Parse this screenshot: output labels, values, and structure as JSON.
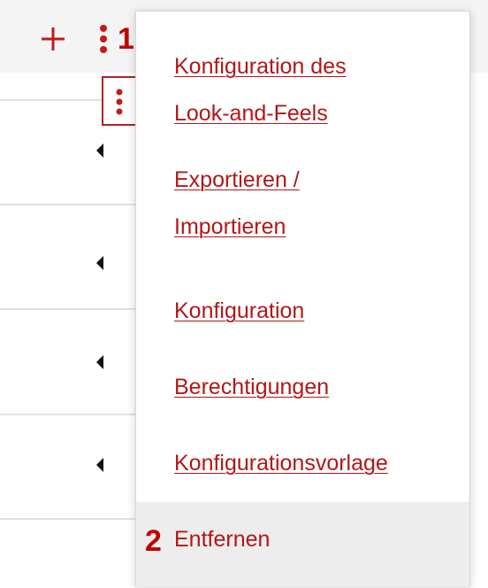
{
  "toolbar": {
    "add_icon": "plus-icon",
    "more_icon": "vertical-ellipsis-icon",
    "annotation_1": "1"
  },
  "rows": [
    {
      "expand_icon": "caret-left-icon"
    },
    {
      "expand_icon": "caret-left-icon"
    },
    {
      "expand_icon": "caret-left-icon"
    },
    {
      "expand_icon": "caret-left-icon"
    }
  ],
  "menu": {
    "items": [
      {
        "label": "Konfiguration des\nLook-and-Feels"
      },
      {
        "label": "Exportieren /\nImportieren"
      },
      {
        "label": "Konfiguration"
      },
      {
        "label": "Berechtigungen"
      },
      {
        "label": "Konfigurationsvorlage"
      },
      {
        "label": "Entfernen"
      }
    ],
    "annotation_2": "2"
  },
  "colors": {
    "accent": "#b01818",
    "toolbar_bg": "#f4f4f4",
    "hover_bg": "#ededed"
  }
}
